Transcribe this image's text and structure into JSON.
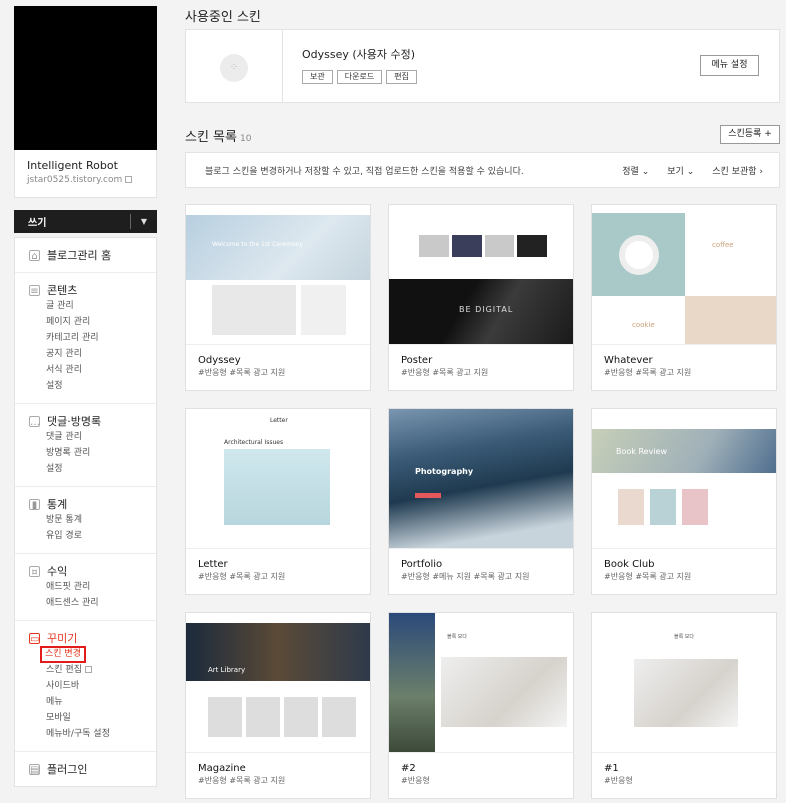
{
  "sidebar": {
    "blog_name": "Intelligent Robot",
    "blog_url": "jstar0525.tistory.com",
    "write_label": "쓰기",
    "sections": [
      {
        "title": "블로그관리 홈",
        "items": []
      },
      {
        "title": "콘텐츠",
        "items": [
          "글 관리",
          "페이지 관리",
          "카테고리 관리",
          "공지 관리",
          "서식 관리",
          "설정"
        ]
      },
      {
        "title": "댓글·방명록",
        "items": [
          "댓글 관리",
          "방명록 관리",
          "설정"
        ]
      },
      {
        "title": "통계",
        "items": [
          "방문 통계",
          "유입 경로"
        ]
      },
      {
        "title": "수익",
        "items": [
          "애드핏 관리",
          "애드센스 관리"
        ]
      },
      {
        "title": "꾸미기",
        "items": [
          "스킨 변경",
          "스킨 편집",
          "사이드바",
          "메뉴",
          "모바일",
          "메뉴바/구독 설정"
        ]
      },
      {
        "title": "플러그인",
        "items": []
      }
    ]
  },
  "current": {
    "heading": "사용중인 스킨",
    "skin_name": "Odyssey (사용자 수정)",
    "buttons": [
      "보관",
      "다운로드",
      "편집"
    ],
    "menu_button": "메뉴 설정"
  },
  "list": {
    "heading": "스킨 목록",
    "count": "10",
    "register_button": "스킨등록 +",
    "info": "블로그 스킨을 변경하거나 저장할 수 있고, 직접 업로드한 스킨을 적용할 수 있습니다.",
    "sort_label": "정렬",
    "view_label": "보기",
    "storage_label": "스킨 보관함"
  },
  "skins": [
    {
      "name": "Odyssey",
      "tags": "#반응형   #목록 광고 지원",
      "thumb": "odyssey"
    },
    {
      "name": "Poster",
      "tags": "#반응형   #목록 광고 지원",
      "thumb": "poster"
    },
    {
      "name": "Whatever",
      "tags": "#반응형   #목록 광고 지원",
      "thumb": "whatever"
    },
    {
      "name": "Letter",
      "tags": "#반응형   #목록 광고 지원",
      "thumb": "letter"
    },
    {
      "name": "Portfolio",
      "tags": "#반응형   #메뉴 지원   #목록 광고 지원",
      "thumb": "portfolio"
    },
    {
      "name": "Book Club",
      "tags": "#반응형   #목록 광고 지원",
      "thumb": "book"
    },
    {
      "name": "Magazine",
      "tags": "#반응형   #목록 광고 지원",
      "thumb": "mag"
    },
    {
      "name": "#2",
      "tags": "#반응형",
      "thumb": "t2"
    },
    {
      "name": "#1",
      "tags": "#반응형",
      "thumb": "t1"
    }
  ],
  "thumb_text": {
    "odyssey_hero": "Welcome to the 1st Ceremony",
    "poster_banner": "BE DIGITAL",
    "whatever_coffee": "coffee",
    "whatever_cookie": "cookie",
    "letter_title": "Letter",
    "letter_heading": "Architectural Issues",
    "portfolio_title": "Photography",
    "book_banner": "Book Review",
    "mag_banner": "Art Library",
    "post_title": "블록 모다"
  },
  "colors": {
    "accent_red": "#e4371e",
    "highlight_border": "#e21b1b"
  }
}
